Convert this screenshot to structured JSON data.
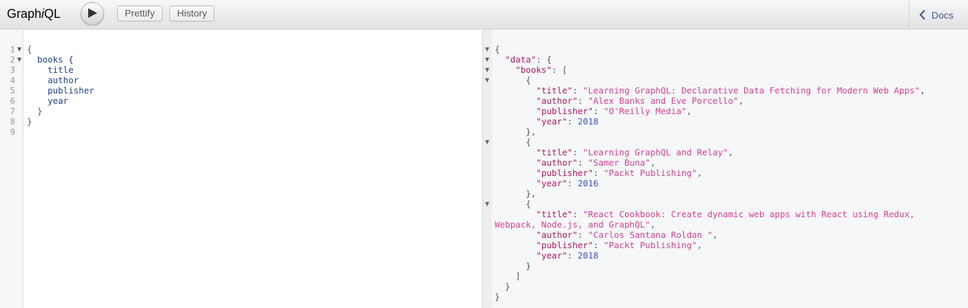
{
  "app": {
    "logo_prefix": "Graph",
    "logo_italic": "i",
    "logo_suffix": "QL"
  },
  "toolbar": {
    "prettify_label": "Prettify",
    "history_label": "History",
    "docs_label": "Docs"
  },
  "query": {
    "line_numbers": [
      "1",
      "2",
      "3",
      "4",
      "5",
      "6",
      "7",
      "8",
      "9"
    ],
    "lines": [
      "{",
      "  books {",
      "    title",
      "    author",
      "    publisher",
      "    year",
      "  }",
      "}",
      ""
    ]
  },
  "result": {
    "books": [
      {
        "title": "Learning GraphQL: Declarative Data Fetching for Modern Web Apps",
        "author": "Alex Banks and Eve Porcello",
        "publisher": "O'Reilly Media",
        "year": 2018
      },
      {
        "title": "Learning GraphQL and Relay",
        "author": "Samer Buna",
        "publisher": "Packt Publishing",
        "year": 2016
      },
      {
        "title": "React Cookbook: Create dynamic web apps with React using Redux, Webpack, Node.js, and GraphQL",
        "author": "Carlos Santana Roldan ",
        "publisher": "Packt Publishing",
        "year": 2018
      }
    ]
  },
  "colors": {
    "key": "#b11a5c",
    "string": "#d64292",
    "number": "#3a52d4",
    "docs_link": "#3b5998"
  }
}
